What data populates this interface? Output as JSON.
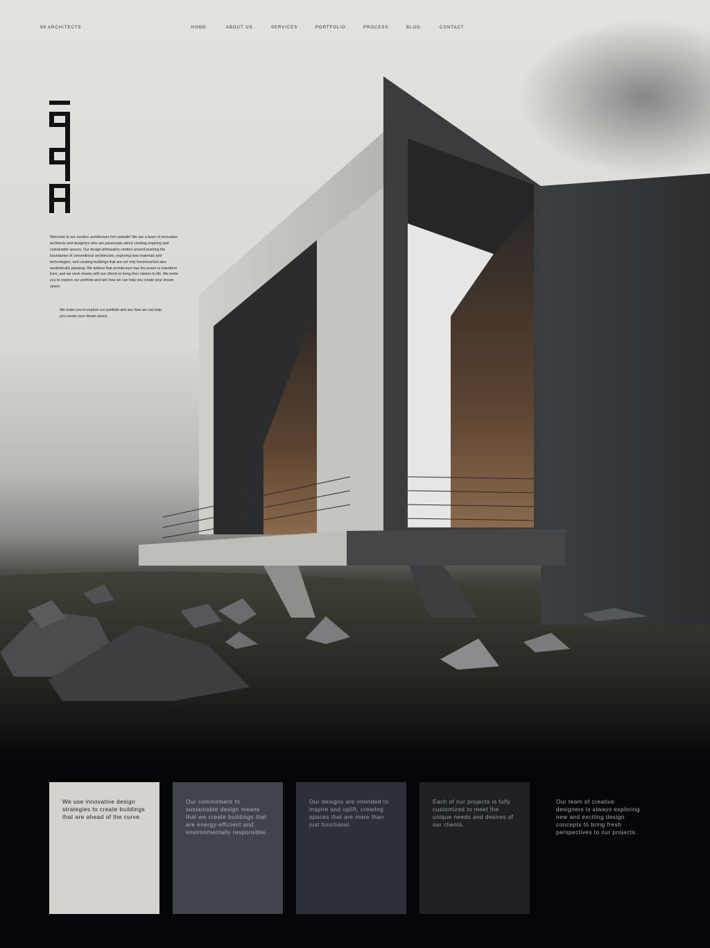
{
  "brand": "99 ARCHITECTS",
  "nav": [
    {
      "label": "HOME",
      "has_dropdown": true
    },
    {
      "label": "ABOUT US",
      "has_dropdown": true
    },
    {
      "label": "SERVICES",
      "has_dropdown": true
    },
    {
      "label": "PORTFOLIO",
      "has_dropdown": true
    },
    {
      "label": "PROCESS",
      "has_dropdown": true
    },
    {
      "label": "BLOG",
      "has_dropdown": true
    },
    {
      "label": "CONTACT",
      "has_dropdown": false
    }
  ],
  "logo_text": "99A",
  "intro": {
    "body": "Welcome to our modern architecture firm website! We are a team of innovative architects and designers who are passionate about creating inspiring and sustainable spaces. Our design philosophy centers around pushing the boundaries of conventional architecture, exploring new materials and technologies, and creating buildings that are not only functional but also aesthetically pleasing. We believe that architecture has the power to transform lives, and we work closely with our clients to bring their visions to life. We invite you to explore our portfolio and see how we can help you create your dream space.",
    "sub": "We invite you to explore our portfolio and see how we can help you create your dream space."
  },
  "cards": [
    {
      "text": "We use innovative design strategies to create buildings that are ahead of the curve.",
      "color": "#d6d3ce"
    },
    {
      "text": "Our commitment to sustainable design means that we create buildings that are energy-efficient and environmentally responsible.",
      "color": "#40454b"
    },
    {
      "text": "Our designs are intended to inspire and uplift, creating spaces that are more than just functional.",
      "color": "#2d3036"
    },
    {
      "text": "Each of our projects is fully customized to meet the unique needs and desires of our clients.",
      "color": "#1f2124"
    },
    {
      "text": "Our team of creative designers is always exploring new and exciting design concepts to bring fresh perspectives to our projects.",
      "color": "transparent"
    }
  ],
  "colors": {
    "page_background": "#06060a",
    "sky": "#e3e2de",
    "text_dark": "#1d1d1d"
  }
}
